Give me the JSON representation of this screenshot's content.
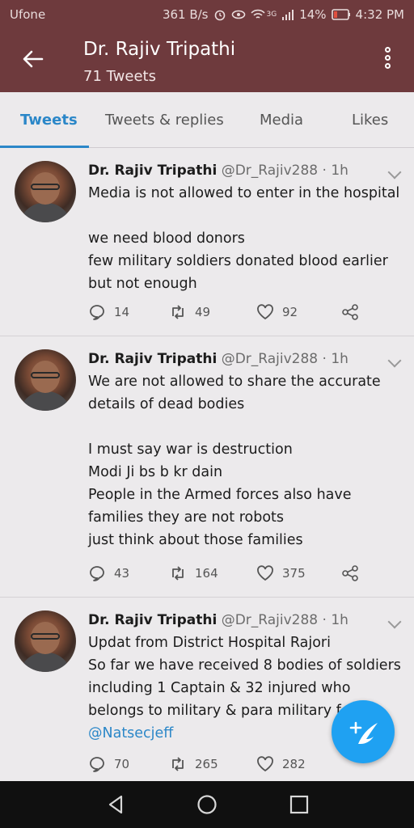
{
  "status": {
    "carrier": "Ufone",
    "speed": "361 B/s",
    "network": "3G",
    "battery": "14%",
    "time": "4:32 PM"
  },
  "header": {
    "title": "Dr. Rajiv Tripathi",
    "subtitle": "71 Tweets"
  },
  "tabs": [
    {
      "label": "Tweets"
    },
    {
      "label": "Tweets & replies"
    },
    {
      "label": "Media"
    },
    {
      "label": "Likes"
    }
  ],
  "tweets": [
    {
      "name": "Dr. Rajiv Tripathi",
      "handle": "@Dr_Rajiv288 · 1h",
      "lines": [
        "Media is not allowed to enter in the hospital",
        "",
        "we need blood donors",
        "few military soldiers donated blood earlier",
        "but not enough"
      ],
      "replies": "14",
      "retweets": "49",
      "likes": "92"
    },
    {
      "name": "Dr. Rajiv Tripathi",
      "handle": "@Dr_Rajiv288 · 1h",
      "lines": [
        "We are not allowed to share the accurate",
        "details of dead bodies",
        "",
        "I must say war is destruction",
        "Modi Ji bs b kr dain",
        "People in the Armed forces also have",
        "families they are not robots",
        "just think about those families"
      ],
      "replies": "43",
      "retweets": "164",
      "likes": "375"
    },
    {
      "name": "Dr. Rajiv Tripathi",
      "handle": "@Dr_Rajiv288 · 1h",
      "lines": [
        "Updat from District Hospital Rajori",
        "So far we have received 8 bodies of soldiers",
        "including 1 Captain & 32 injured who",
        "belongs to military & para  military f"
      ],
      "mention": "@Natsecjeff",
      "replies": "70",
      "retweets": "265",
      "likes": "282"
    }
  ]
}
